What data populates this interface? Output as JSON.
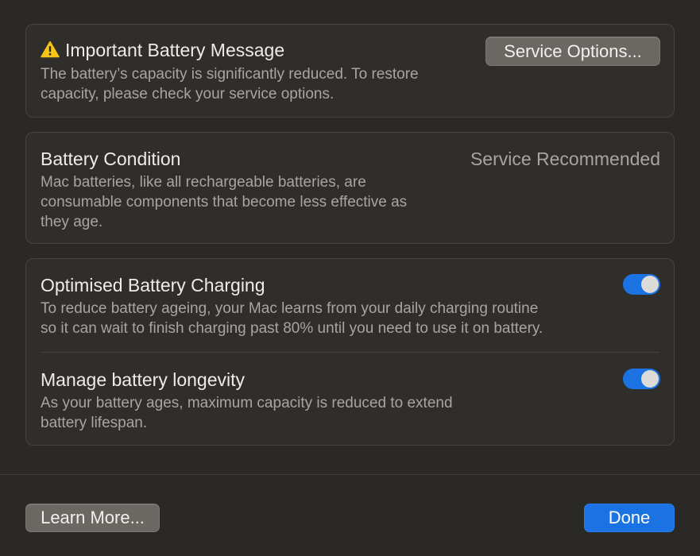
{
  "message": {
    "title": "Important Battery Message",
    "icon": "warning-triangle",
    "description_lines": [
      "The battery’s capacity is significantly reduced. To restore",
      "capacity, please check your service options."
    ],
    "service_button": "Service Options..."
  },
  "condition": {
    "title": "Battery Condition",
    "status": "Service Recommended",
    "description_lines": [
      "Mac batteries, like all rechargeable batteries, are",
      "consumable components that become less effective as",
      "they age."
    ]
  },
  "optimised_charging": {
    "title": "Optimised Battery Charging",
    "enabled": true,
    "description_lines": [
      "To reduce battery ageing, your Mac learns from your daily charging routine",
      "so it can wait to finish charging past 80% until you need to use it on battery."
    ]
  },
  "longevity": {
    "title": "Manage battery longevity",
    "enabled": true,
    "description_lines": [
      "As your battery ages, maximum capacity is reduced to extend",
      "battery lifespan."
    ]
  },
  "footer": {
    "learn_more": "Learn More...",
    "done": "Done"
  },
  "colors": {
    "accent": "#1b72e2",
    "warning": "#f5c518",
    "background": "#2b2925"
  }
}
